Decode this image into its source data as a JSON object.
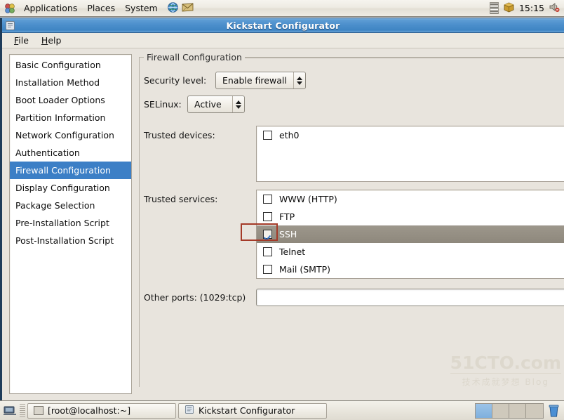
{
  "top_panel": {
    "menus": [
      "Applications",
      "Places",
      "System"
    ],
    "app_icons": [
      "globe-browser-icon",
      "email-client-icon"
    ],
    "status": {
      "cpu_monitor_icon": "cpu-monitor-icon",
      "updates_icon": "package-updates-icon",
      "clock": "15:15",
      "volume_icon": "volume-muted-icon"
    }
  },
  "window": {
    "title": "Kickstart Configurator",
    "icon": "kickstart-app-icon",
    "menubar": [
      {
        "label": "Help",
        "mnemonic": "F",
        "text_before": "",
        "full": "File"
      },
      {
        "label": "Help",
        "mnemonic": "H",
        "full": "Help"
      }
    ],
    "menu_file": "File",
    "menu_file_mnemonic": "F",
    "menu_file_rest": "ile",
    "menu_help": "Help",
    "menu_help_mnemonic": "H",
    "menu_help_rest": "elp"
  },
  "sidebar": {
    "items": [
      {
        "label": "Basic Configuration",
        "selected": false
      },
      {
        "label": "Installation Method",
        "selected": false
      },
      {
        "label": "Boot Loader Options",
        "selected": false
      },
      {
        "label": "Partition Information",
        "selected": false
      },
      {
        "label": "Network Configuration",
        "selected": false
      },
      {
        "label": "Authentication",
        "selected": false
      },
      {
        "label": "Firewall Configuration",
        "selected": true
      },
      {
        "label": "Display Configuration",
        "selected": false
      },
      {
        "label": "Package Selection",
        "selected": false
      },
      {
        "label": "Pre-Installation Script",
        "selected": false
      },
      {
        "label": "Post-Installation Script",
        "selected": false
      }
    ]
  },
  "main": {
    "group_title": "Firewall Configuration",
    "security_level": {
      "label": "Security level:",
      "value": "Enable firewall"
    },
    "selinux": {
      "label": "SELinux:",
      "value": "Active"
    },
    "trusted_devices": {
      "label": "Trusted devices:",
      "items": [
        {
          "label": "eth0",
          "checked": false,
          "selected": false
        }
      ]
    },
    "trusted_services": {
      "label": "Trusted services:",
      "items": [
        {
          "label": "WWW (HTTP)",
          "checked": false,
          "selected": false
        },
        {
          "label": "FTP",
          "checked": false,
          "selected": false
        },
        {
          "label": "SSH",
          "checked": true,
          "selected": true
        },
        {
          "label": "Telnet",
          "checked": false,
          "selected": false
        },
        {
          "label": "Mail (SMTP)",
          "checked": false,
          "selected": false
        }
      ]
    },
    "other_ports": {
      "label": "Other ports: (1029:tcp)",
      "value": "",
      "placeholder": ""
    }
  },
  "watermark": {
    "main": "51CTO.com",
    "sub": "技术成就梦想 Blog"
  },
  "taskbar": {
    "show_desktop_icon": "show-desktop-icon",
    "buttons": [
      {
        "label": "[root@localhost:~]",
        "icon": "terminal-icon",
        "active": false
      },
      {
        "label": "Kickstart Configurator",
        "icon": "kickstart-app-icon",
        "active": true
      }
    ],
    "workspaces": [
      {
        "active": true
      },
      {
        "active": false
      },
      {
        "active": false
      },
      {
        "active": false
      }
    ],
    "trash_icon": "trash-icon"
  },
  "colors": {
    "selection_blue": "#3c7fc6",
    "titlebar_blue": "#4a8ecb",
    "annotation_red": "#a43a28",
    "window_bg": "#e8e4dd",
    "row_selected_grey": "#958f84"
  }
}
